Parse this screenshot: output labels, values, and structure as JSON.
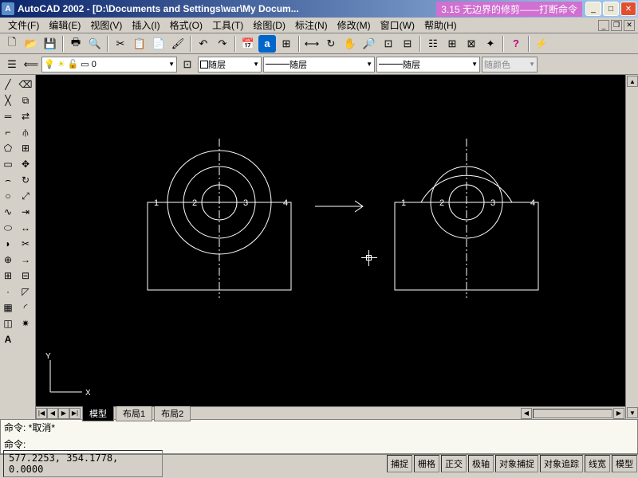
{
  "title": {
    "app": "AutoCAD 2002 - ",
    "path": "[D:\\Documents and Settings\\war\\My Docum...",
    "overlay": "3.15 无边界的修剪——打断命令"
  },
  "menu": [
    {
      "label": "文件(F)"
    },
    {
      "label": "编辑(E)"
    },
    {
      "label": "视图(V)"
    },
    {
      "label": "插入(I)"
    },
    {
      "label": "格式(O)"
    },
    {
      "label": "工具(T)"
    },
    {
      "label": "绘图(D)"
    },
    {
      "label": "标注(N)"
    },
    {
      "label": "修改(M)"
    },
    {
      "label": "窗口(W)"
    },
    {
      "label": "帮助(H)"
    }
  ],
  "properties": {
    "layer_controls": {
      "bulb": "●",
      "sun": "☀",
      "lock": "▭"
    },
    "layer_name": "0",
    "color_label": "随层",
    "linetype_label": "随层",
    "lineweight_label": "随层",
    "plotstyle_label": "随颜色"
  },
  "drawing": {
    "labels": [
      "1",
      "2",
      "3",
      "4"
    ],
    "ucs": {
      "x": "X",
      "y": "Y"
    }
  },
  "tabs": {
    "active": "模型",
    "layouts": [
      "布局1",
      "布局2"
    ]
  },
  "command": {
    "history": "命令: *取消*",
    "prompt": "命令:"
  },
  "status": {
    "coords": "577.2253, 354.1778, 0.0000",
    "toggles": [
      "捕捉",
      "栅格",
      "正交",
      "极轴",
      "对象捕捉",
      "对象追踪",
      "线宽",
      "模型"
    ]
  }
}
